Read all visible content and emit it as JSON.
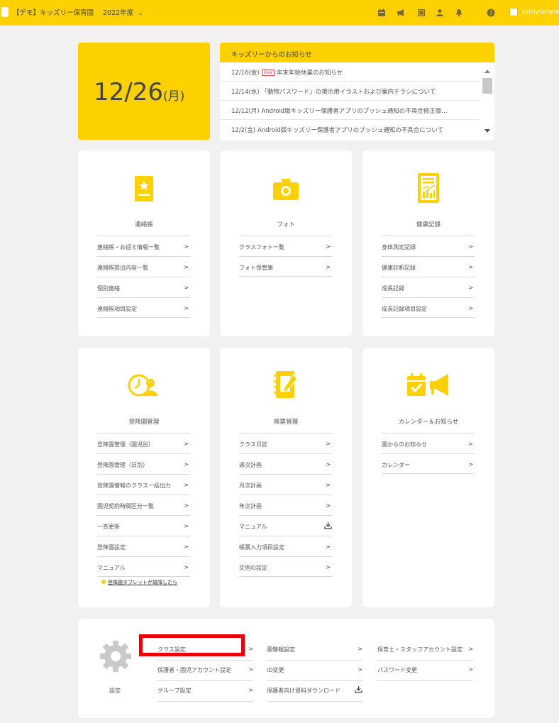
{
  "header": {
    "app_title": "【デモ】キッズリー保育園",
    "year": "2022年度",
    "icons": [
      "calendar-icon",
      "megaphone-icon",
      "document-icon",
      "user-icon",
      "bell-icon",
      "help-icon"
    ],
    "account_name": "kidslysample"
  },
  "date": {
    "day": "12/26",
    "weekday": "(月)"
  },
  "news": {
    "title": "キッズリーからのお知らせ",
    "items": [
      {
        "date": "12/16(金)",
        "badge": "new",
        "text": "年末年始休業のお知らせ"
      },
      {
        "date": "12/14(水)",
        "badge": "",
        "text": "「動物パスワード」の掲示用イラストおよび案内チラシについて"
      },
      {
        "date": "12/12(月)",
        "badge": "",
        "text": "Android版キッズリー保護者アプリのプッシュ通知の不具合修正版…"
      },
      {
        "date": "12/2(金)",
        "badge": "",
        "text": "Android版キッズリー保護者アプリのプッシュ通知の不具合について"
      }
    ]
  },
  "cards": [
    {
      "title": "連絡帳",
      "icon": "contact-book-icon",
      "links": [
        "連絡帳・お迎え情報一覧",
        "連絡帳提出内容一覧",
        "個別連絡",
        "連絡帳項目設定"
      ]
    },
    {
      "title": "フォト",
      "icon": "camera-icon",
      "links": [
        "クラスフォト一覧",
        "フォト保管庫"
      ]
    },
    {
      "title": "健康記録",
      "icon": "health-chart-icon",
      "links": [
        "身体測定記録",
        "健康診断記録",
        "成長記録",
        "成長記録項目設定"
      ]
    },
    {
      "title": "登降園管理",
      "icon": "attendance-clock-icon",
      "links": [
        "登降園管理（園児別）",
        "登降園管理（日別）",
        "登降園情報のクラス一括出力",
        "園児契約時間区分一覧",
        "一斉更新",
        "登降園設定",
        "マニュアル"
      ],
      "note": "登降園タブレットが故障したら"
    },
    {
      "title": "帳票管理",
      "icon": "notebook-pen-icon",
      "links": [
        "クラス日誌",
        "週次計画",
        "月次計画",
        "年次計画",
        "マニュアル",
        "帳票入力項目設定",
        "文例の設定"
      ]
    },
    {
      "title": "カレンダー＆お知らせ",
      "icon": "calendar-announce-icon",
      "links": [
        "園からのお知らせ",
        "カレンダー"
      ]
    }
  ],
  "settings": {
    "label": "設定",
    "col1": [
      "クラス設定",
      "保護者・園児アカウント設定",
      "グループ設定"
    ],
    "col2": [
      "園情報設定",
      "ID変更",
      "保護者向け資料ダウンロード"
    ],
    "col3": [
      "保育士・スタッフアカウント設定",
      "パスワード変更"
    ]
  },
  "colors": {
    "accent": "#fdd000",
    "highlight": "#e8000b"
  }
}
